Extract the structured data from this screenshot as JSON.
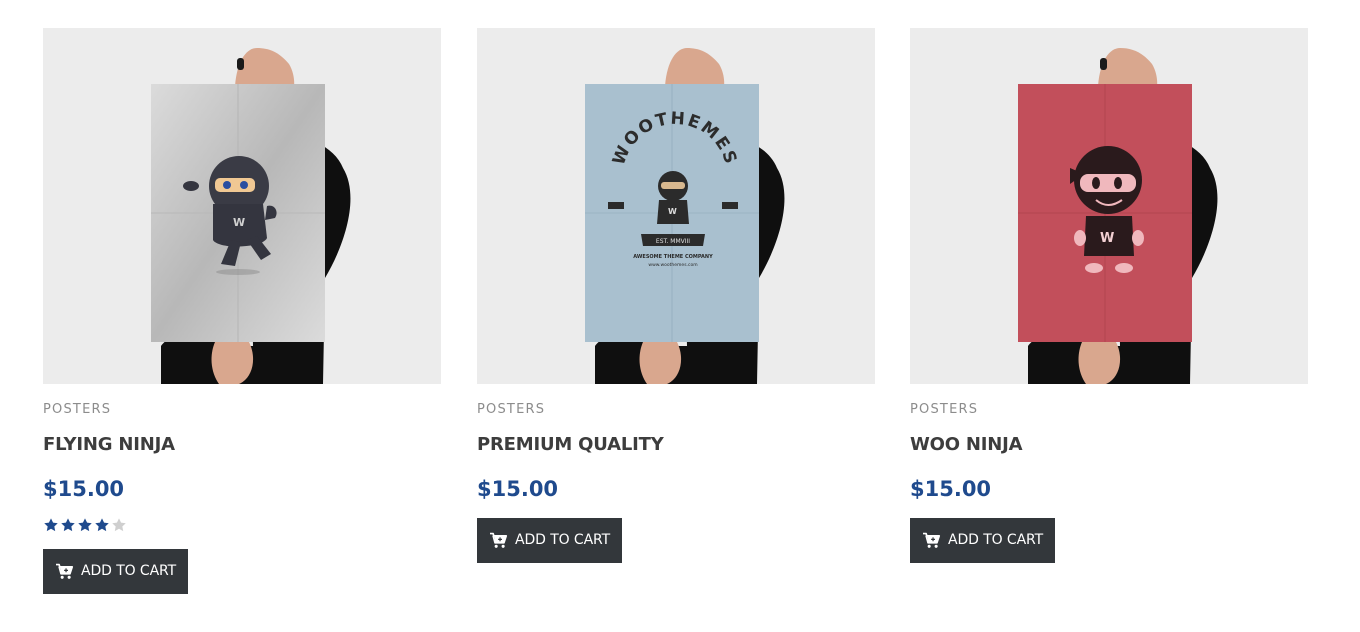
{
  "products": [
    {
      "category": "POSTERS",
      "name": "FLYING NINJA",
      "price": "$15.00",
      "rating": 4,
      "rating_max": 5,
      "button_label": "ADD TO CART",
      "poster_color": "#c8c8c8"
    },
    {
      "category": "POSTERS",
      "name": "PREMIUM QUALITY",
      "price": "$15.00",
      "button_label": "ADD TO CART",
      "poster_color": "#a9c0cf",
      "poster_text": {
        "arc": "WOOTHEMES",
        "banner": "EST. MMVIII",
        "line1": "AWESOME THEME COMPANY",
        "line2": "www.woothemes.com"
      }
    },
    {
      "category": "POSTERS",
      "name": "WOO NINJA",
      "price": "$15.00",
      "button_label": "ADD TO CART",
      "poster_color": "#c24f5b"
    }
  ],
  "colors": {
    "price": "#1f4a8d",
    "button_bg": "#33373b",
    "star_filled": "#1f4a8d",
    "star_empty": "#cfcfcf",
    "image_bg": "#ececec"
  },
  "icons": {
    "cart": "cart-icon",
    "star": "star-icon"
  }
}
